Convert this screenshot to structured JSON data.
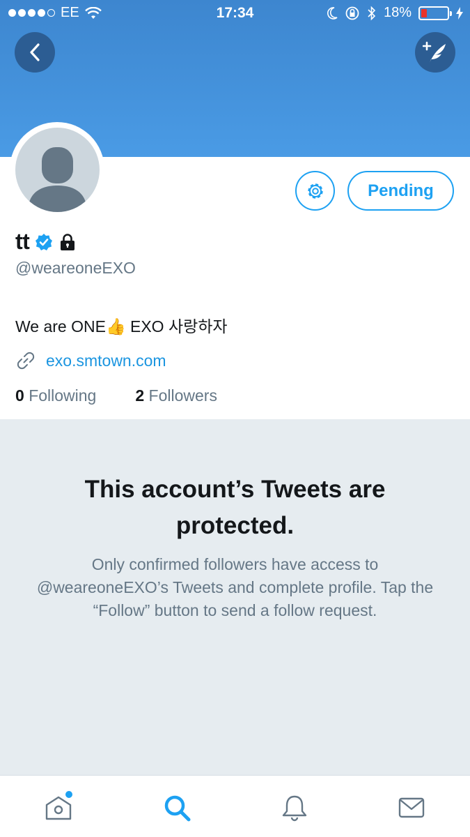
{
  "status_bar": {
    "carrier": "EE",
    "time": "17:34",
    "battery": "18%"
  },
  "header": {
    "back_icon": "chevron-left-icon",
    "compose_icon": "compose-tweet-icon"
  },
  "profile": {
    "name": "tt",
    "handle": "@weareoneEXO",
    "bio": "We are ONE👍 EXO 사랑하자",
    "website": "exo.smtown.com",
    "verified": true,
    "protected": true
  },
  "actions": {
    "settings_icon": "gear-icon",
    "pending_label": "Pending"
  },
  "counts": {
    "following_count": "0",
    "following_label": "Following",
    "followers_count": "2",
    "followers_label": "Followers"
  },
  "protected_notice": {
    "title": "This account’s Tweets are protected.",
    "description": "Only confirmed followers have access to @weareoneEXO’s Tweets and complete profile. Tap the “Follow” button to send a follow request."
  },
  "tabbar": {
    "tabs": [
      "home-icon",
      "search-icon",
      "bell-icon",
      "mail-icon"
    ]
  },
  "colors": {
    "accent": "#1da1f2",
    "header": "#4a9be5",
    "protected_bg": "#e6ecf0"
  }
}
